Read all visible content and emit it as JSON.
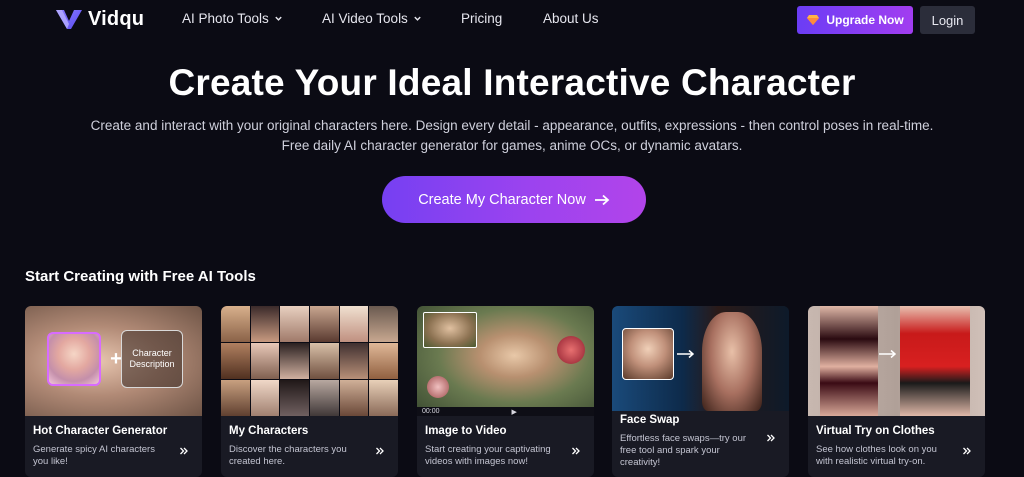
{
  "brand": {
    "name": "Vidqu"
  },
  "nav": {
    "items": [
      {
        "label": "AI Photo Tools",
        "has_dropdown": true
      },
      {
        "label": "AI Video Tools",
        "has_dropdown": true
      },
      {
        "label": "Pricing",
        "has_dropdown": false
      },
      {
        "label": "About Us",
        "has_dropdown": false
      }
    ],
    "upgrade_label": "Upgrade Now",
    "login_label": "Login"
  },
  "hero": {
    "title": "Create Your Ideal Interactive Character",
    "subtitle_line1": "Create and interact with your original characters here. Design every detail - appearance, outfits, expressions - then control poses in real-time.",
    "subtitle_line2": "Free daily AI character generator for games, anime OCs, or dynamic avatars.",
    "cta_label": "Create My Character Now"
  },
  "tools": {
    "section_title": "Start Creating with Free AI Tools",
    "cards": [
      {
        "title": "Hot Character Generator",
        "desc": "Generate spicy AI characters you like!",
        "overlay_label": "Character Description",
        "icon": "chevron-double-right-icon"
      },
      {
        "title": "My Characters",
        "desc": "Discover the characters you created here.",
        "icon": "chevron-double-right-icon"
      },
      {
        "title": "Image to Video",
        "desc": "Start creating your captivating videos with images now!",
        "player_time": "00:00",
        "icon": "chevron-double-right-icon"
      },
      {
        "title": "Face Swap",
        "desc": "Effortless face swaps—try our free tool and spark your creativity!",
        "icon": "chevron-double-right-icon"
      },
      {
        "title": "Virtual Try on Clothes",
        "desc": "See how clothes look on you with realistic virtual try-on.",
        "icon": "chevron-double-right-icon"
      }
    ]
  },
  "colors": {
    "background": "#0b0b14",
    "accent_gradient_start": "#7640f2",
    "accent_gradient_end": "#b244ea",
    "card_bg": "#191a24"
  }
}
